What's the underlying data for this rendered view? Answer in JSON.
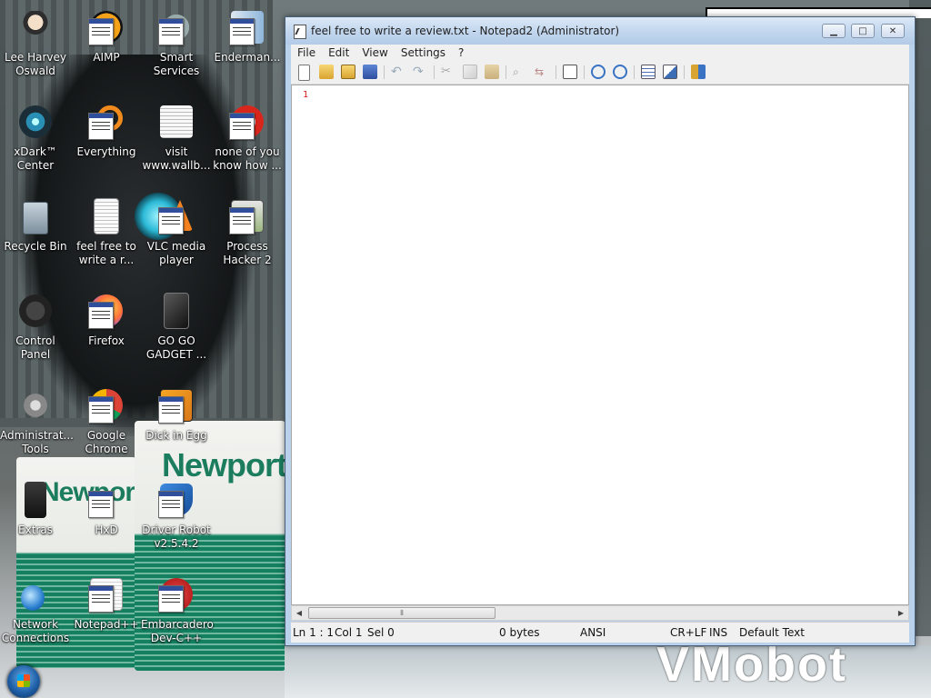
{
  "desktop": {
    "wallpaper": {
      "box_brand": "Newport",
      "robot_text": "VMobot"
    },
    "icons": [
      {
        "label": "Lee Harvey Oswald",
        "icon": "person-icon"
      },
      {
        "label": "AIMP",
        "icon": "aimp-icon"
      },
      {
        "label": "Smart Services",
        "icon": "gear-services-icon"
      },
      {
        "label": "Enderman...",
        "icon": "enderman-icon"
      },
      {
        "label": "xDark™ Center",
        "icon": "webcam-icon"
      },
      {
        "label": "Everything",
        "icon": "search-magnifier-icon"
      },
      {
        "label": "visit www.wallb...",
        "icon": "text-document-icon"
      },
      {
        "label": "none of you know how ...",
        "icon": "red-circle-icon"
      },
      {
        "label": "Recycle Bin",
        "icon": "recycle-bin-icon"
      },
      {
        "label": "feel free to write a r...",
        "icon": "text-document-icon"
      },
      {
        "label": "VLC media player",
        "icon": "vlc-cone-icon"
      },
      {
        "label": "Process Hacker 2",
        "icon": "process-hacker-icon"
      },
      {
        "label": "Control Panel",
        "icon": "control-panel-icon"
      },
      {
        "label": "Firefox",
        "icon": "firefox-icon"
      },
      {
        "label": "GO GO GADGET ...",
        "icon": "black-box-icon"
      },
      {
        "label": "Administrat... Tools",
        "icon": "admin-tools-icon"
      },
      {
        "label": "Google Chrome",
        "icon": "chrome-icon"
      },
      {
        "label": "Dick in Egg",
        "icon": "orange-tile-icon"
      },
      {
        "label": "Extras",
        "icon": "extras-folder-icon"
      },
      {
        "label": "HxD",
        "icon": "hex-editor-icon"
      },
      {
        "label": "Driver Robot v2.5.4.2",
        "icon": "windows-shield-icon"
      },
      {
        "label": "Network Connections",
        "icon": "network-globe-icon"
      },
      {
        "label": "Notepad++",
        "icon": "notepadpp-icon"
      },
      {
        "label": "Embarcadero Dev-C++",
        "icon": "devcpp-icon"
      }
    ]
  },
  "window": {
    "title": "feel free to write a review.txt - Notepad2 (Administrator)",
    "buttons": {
      "minimize": "▁",
      "maximize": "□",
      "close": "✕"
    },
    "menu": [
      "File",
      "Edit",
      "View",
      "Settings",
      "?"
    ],
    "editor": {
      "line_number": "1",
      "content": ""
    },
    "scroll_thumb_grip": "⦀",
    "status": {
      "position": "Ln 1 : 1",
      "col": "Col 1",
      "sel": "Sel 0",
      "size": "0 bytes",
      "encoding": "ANSI",
      "line_ending": "CR+LF",
      "mode": "INS",
      "scheme": "Default Text"
    }
  },
  "taskbar": {
    "start": "start-orb"
  }
}
